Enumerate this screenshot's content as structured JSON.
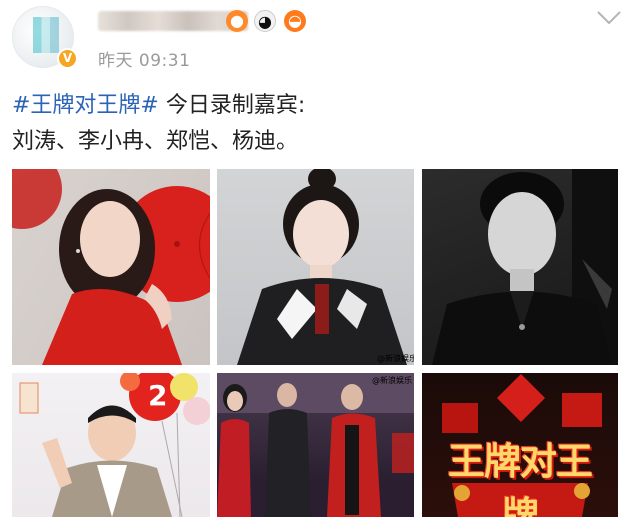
{
  "header": {
    "time": "昨天 09:31",
    "verified_badge": "V",
    "emoji_icons": [
      "lantern-icon",
      "panda-icon",
      "hotpot-icon"
    ],
    "menu_icon": "chevron-down-icon"
  },
  "post": {
    "hashtag": "#王牌对王牌#",
    "line1_rest": " 今日录制嘉宾:",
    "line2": "刘涛、李小冉、郑恺、杨迪。"
  },
  "images": {
    "watermark_1": "@新浪娱乐",
    "watermark_2": "@新浪娱乐",
    "show_logo": "王牌对王牌",
    "balloon_number": "2"
  },
  "colors": {
    "hashtag_blue": "#2b63b6",
    "badge_orange": "#f6a623",
    "meta_gray": "#9a9a9a"
  }
}
